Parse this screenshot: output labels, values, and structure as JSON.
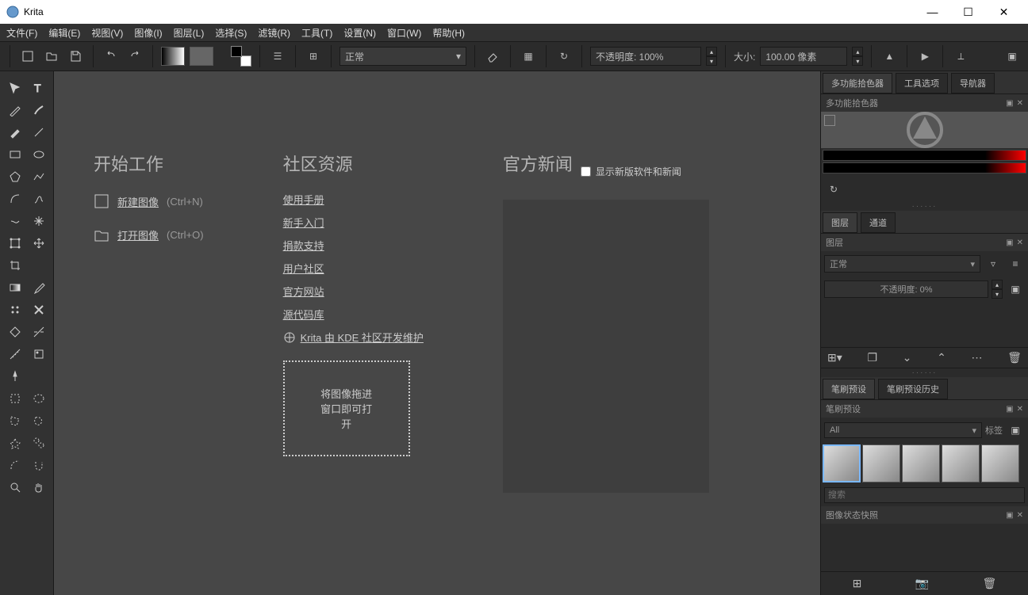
{
  "window": {
    "title": "Krita"
  },
  "menubar": [
    "文件(F)",
    "编辑(E)",
    "视图(V)",
    "图像(I)",
    "图层(L)",
    "选择(S)",
    "滤镜(R)",
    "工具(T)",
    "设置(N)",
    "窗口(W)",
    "帮助(H)"
  ],
  "toolbar": {
    "blend_mode": "正常",
    "opacity": "不透明度:  100%",
    "size_label": "大小:",
    "size_value": "100.00 像素"
  },
  "start": {
    "header": "开始工作",
    "new_image": "新建图像",
    "new_shortcut": "(Ctrl+N)",
    "open_image": "打开图像",
    "open_shortcut": "(Ctrl+O)"
  },
  "community": {
    "header": "社区资源",
    "links": [
      "使用手册",
      "新手入门",
      "捐款支持",
      "用户社区",
      "官方网站",
      "源代码库",
      "Krita 由 KDE 社区开发维护"
    ],
    "dropzone": "将图像拖进窗口即可打开"
  },
  "news": {
    "header": "官方新闻",
    "checkbox_label": "显示新版软件和新闻"
  },
  "right_tabs_top": [
    "多功能拾色器",
    "工具选项",
    "导航器"
  ],
  "panel_color_title": "多功能拾色器",
  "layers": {
    "tabs": [
      "图层",
      "通道"
    ],
    "title": "图层",
    "blend": "正常",
    "opacity": "不透明度:    0%"
  },
  "brush_tabs": [
    "笔刷预设",
    "笔刷预设历史"
  ],
  "brush_title": "笔刷预设",
  "brush_filter": "All",
  "brush_tag": "标签",
  "brush_search": "搜索",
  "snapshot_title": "图像状态快照"
}
